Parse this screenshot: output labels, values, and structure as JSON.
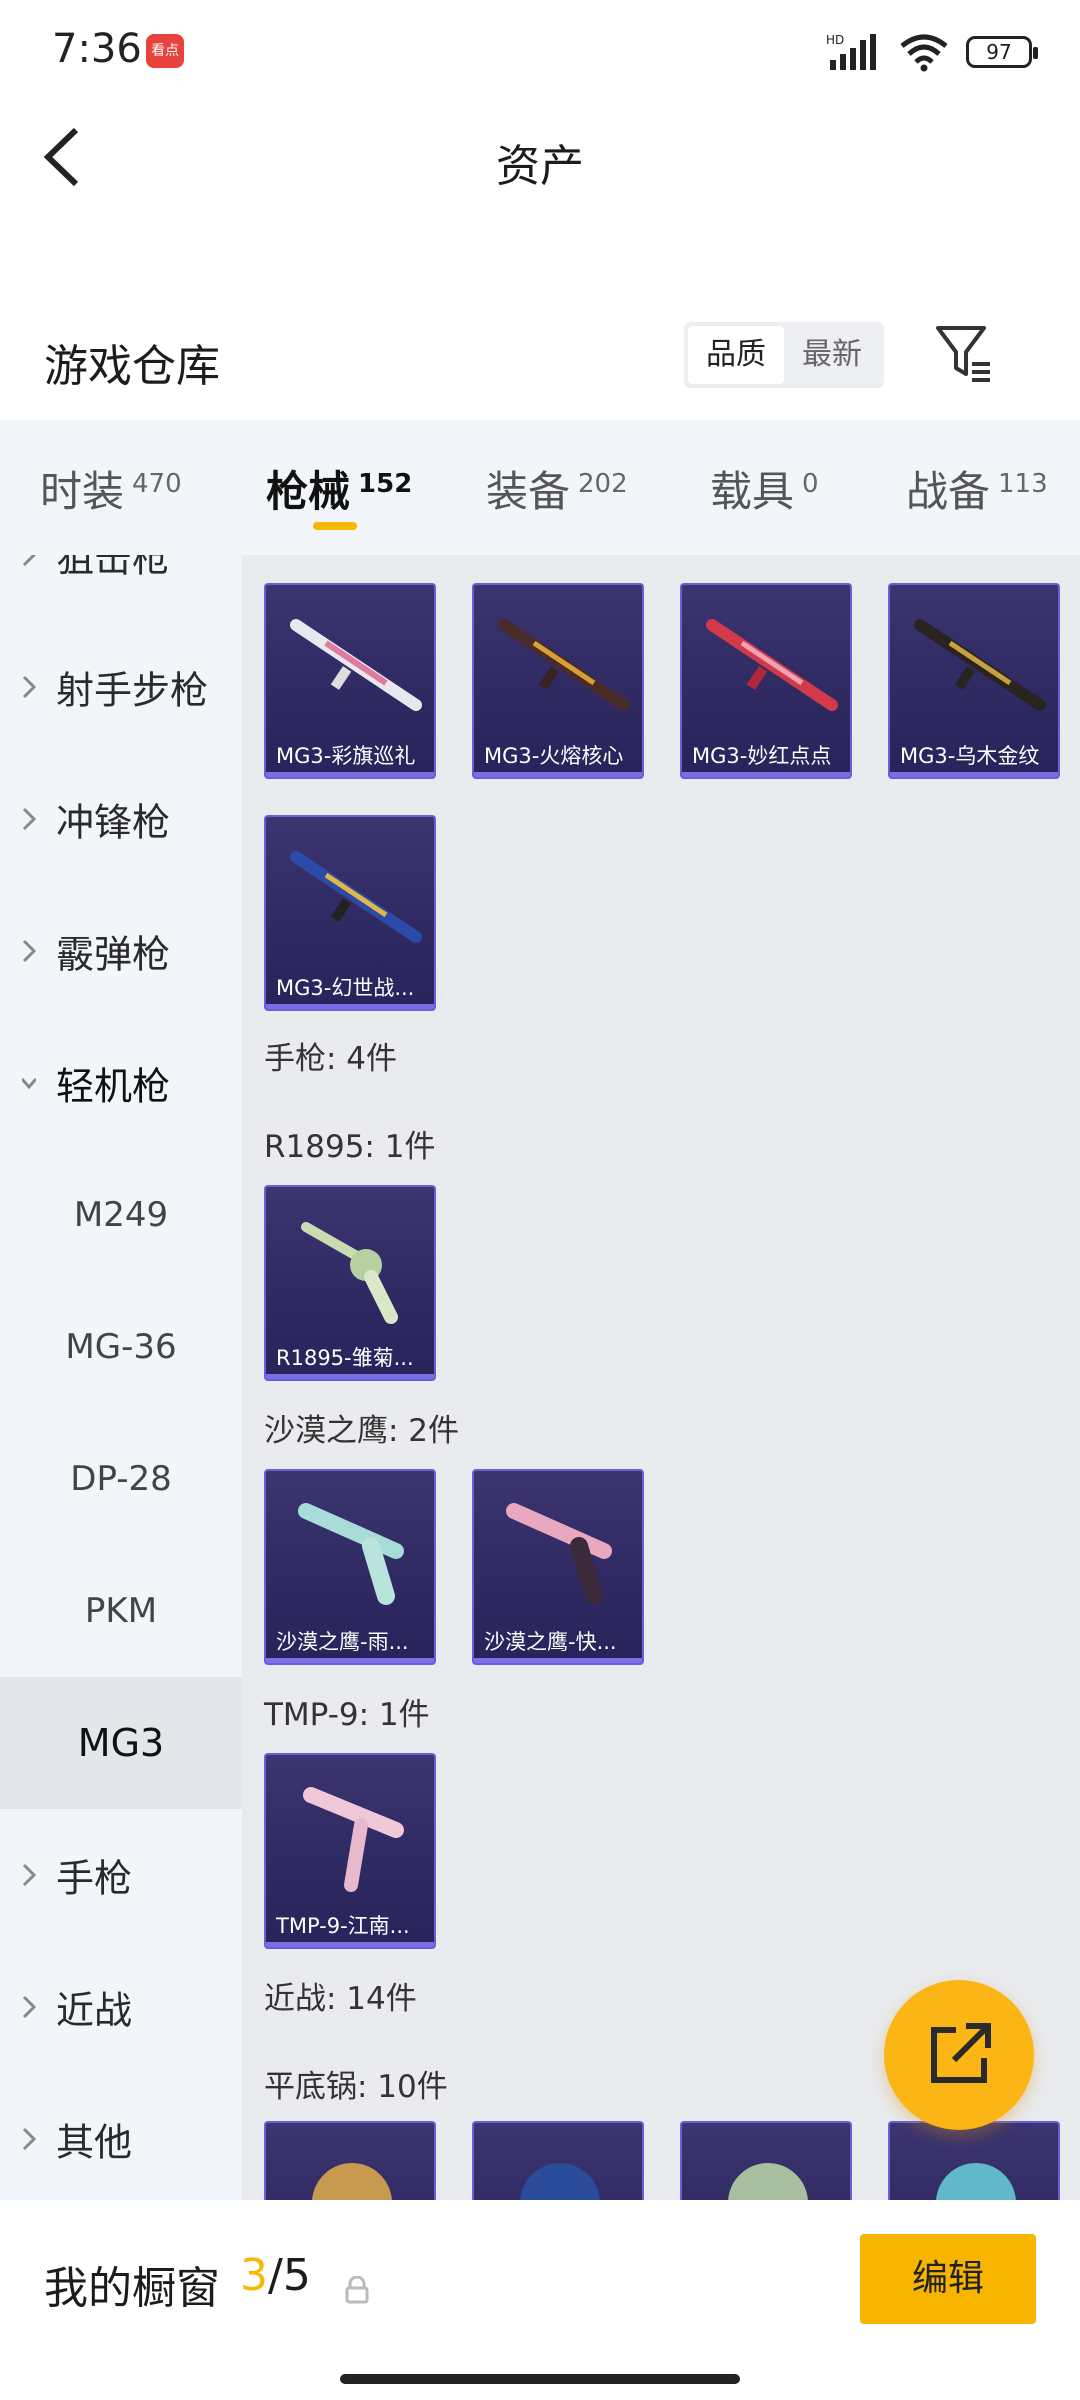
{
  "status_bar": {
    "time": "7:36",
    "app_badge": "看点",
    "battery": "97",
    "network": "HD"
  },
  "header": {
    "title": "资产",
    "back_icon": "chevron-left-icon"
  },
  "warehouse": {
    "title": "游戏仓库",
    "sort_options": [
      "品质",
      "最新"
    ],
    "active_sort": "品质",
    "filter_icon": "filter-icon"
  },
  "tabs": [
    {
      "label": "时装",
      "count": "470"
    },
    {
      "label": "枪械",
      "count": "152",
      "active": true
    },
    {
      "label": "装备",
      "count": "202"
    },
    {
      "label": "载具",
      "count": "0"
    },
    {
      "label": "战备",
      "count": "113"
    }
  ],
  "sidebar": {
    "items": [
      {
        "label": "狙击枪"
      },
      {
        "label": "射手步枪"
      },
      {
        "label": "冲锋枪"
      },
      {
        "label": "霰弹枪"
      },
      {
        "label": "轻机枪",
        "expanded": true
      },
      {
        "label": "M249"
      },
      {
        "label": "MG-36"
      },
      {
        "label": "DP-28"
      },
      {
        "label": "PKM"
      },
      {
        "label": "MG3",
        "selected": true
      },
      {
        "label": "手枪"
      },
      {
        "label": "近战"
      },
      {
        "label": "其他"
      }
    ]
  },
  "content": {
    "mg3_items": [
      "MG3-彩旗巡礼",
      "MG3-火熔核心",
      "MG3-妙红点点",
      "MG3-乌木金纹",
      "MG3-幻世战..."
    ],
    "sections": {
      "pistol": "手枪: 4件",
      "r1895": "R1895: 1件",
      "deagle": "沙漠之鹰: 2件",
      "tmp9": "TMP-9: 1件",
      "melee": "近战: 14件",
      "pan": "平底锅: 10件"
    },
    "r1895_items": [
      "R1895-雏菊..."
    ],
    "deagle_items": [
      "沙漠之鹰-雨...",
      "沙漠之鹰-快..."
    ],
    "tmp9_items": [
      "TMP-9-江南..."
    ],
    "pan_items": [
      "",
      "",
      "",
      ""
    ]
  },
  "fab": {
    "icon": "share-external-icon"
  },
  "bottom_bar": {
    "label": "我的橱窗",
    "current": "3",
    "separator": "/",
    "total": "5",
    "lock_icon": "lock-icon",
    "edit_label": "编辑"
  }
}
